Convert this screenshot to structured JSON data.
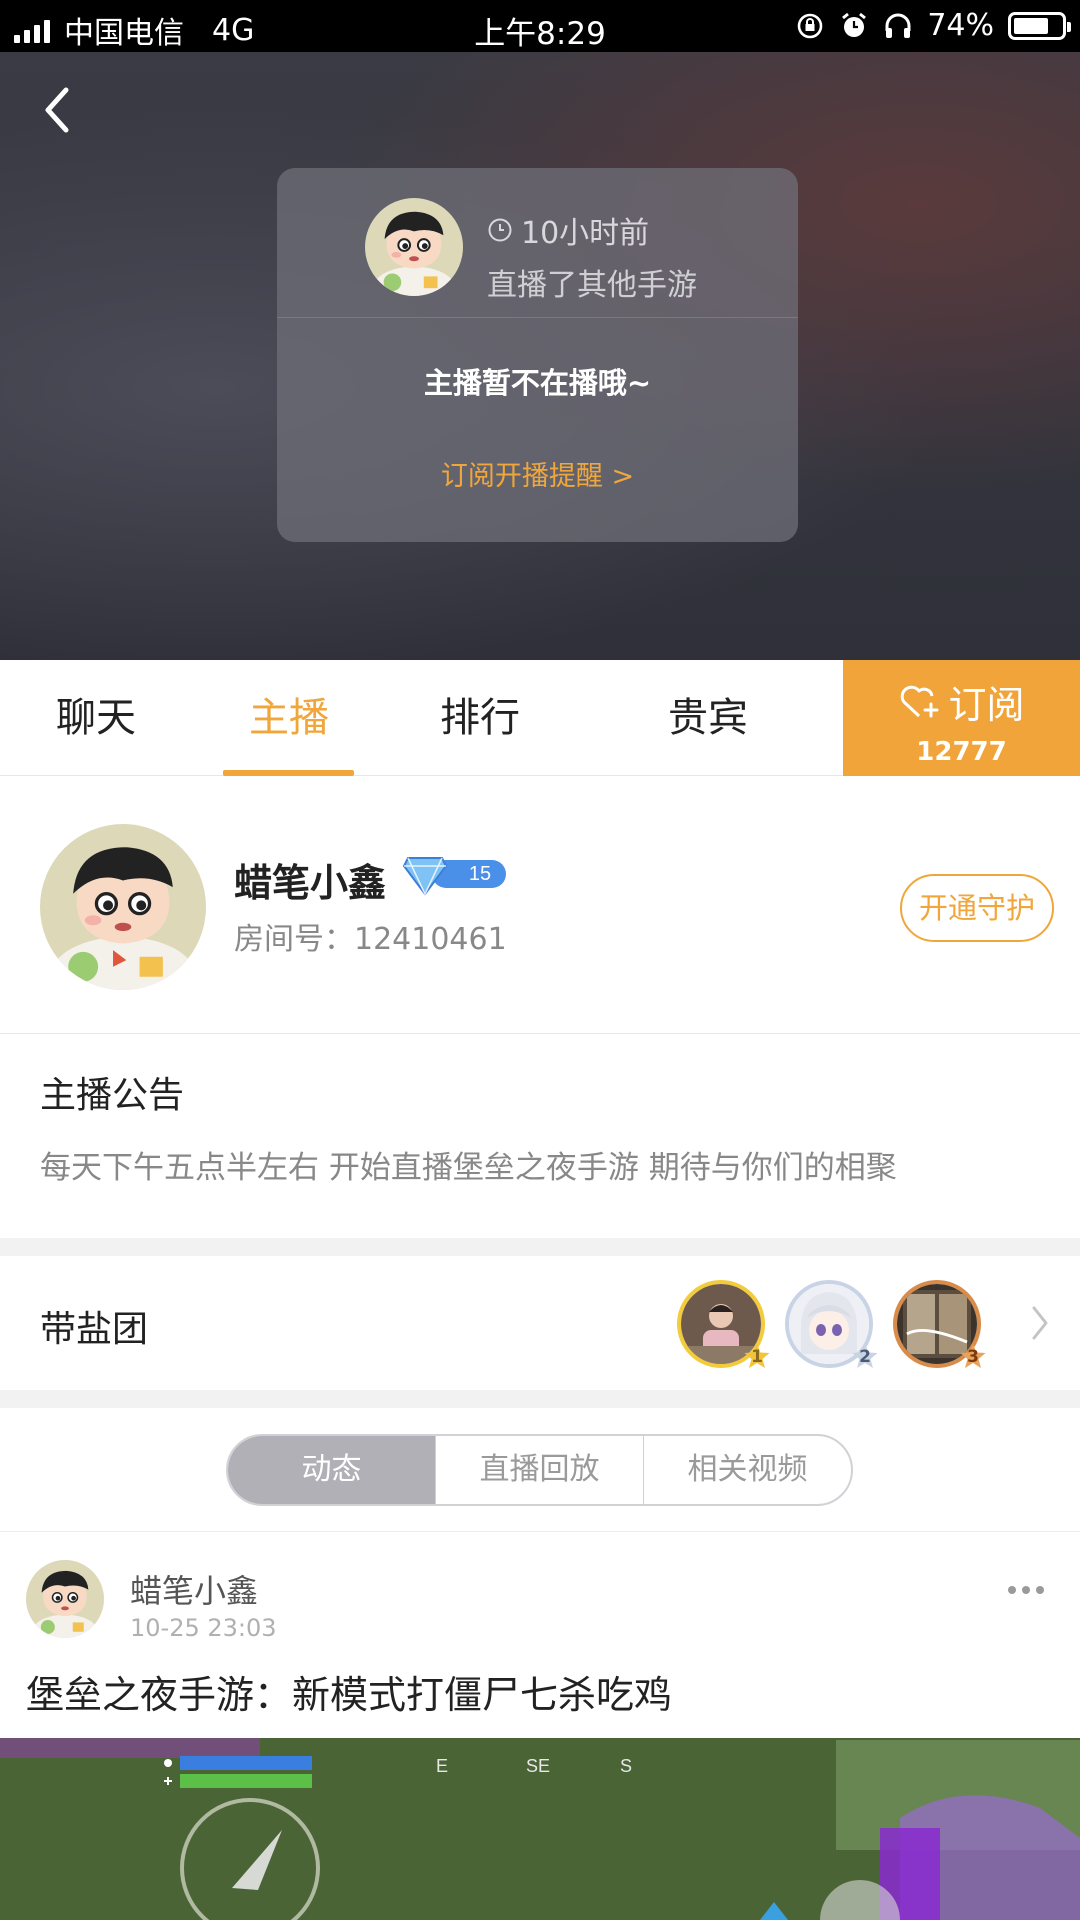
{
  "status_bar": {
    "carrier": "中国电信",
    "network": "4G",
    "time": "上午8:29",
    "battery": "74%"
  },
  "offline_card": {
    "time_ago": "10小时前",
    "description": "直播了其他手游",
    "message": "主播暂不在播哦~",
    "subscribe_reminder": "订阅开播提醒 >"
  },
  "tabs": [
    {
      "label": "聊天"
    },
    {
      "label": "主播"
    },
    {
      "label": "排行"
    },
    {
      "label": "贵宾"
    }
  ],
  "subscribe": {
    "label": "订阅",
    "count": "12777"
  },
  "streamer": {
    "name": "蜡笔小鑫",
    "level": "15",
    "room_id": "房间号：12410461",
    "guard_button": "开通守护"
  },
  "notice": {
    "title": "主播公告",
    "body": "每天下午五点半左右 开始直播堡垒之夜手游  期待与你们的相聚"
  },
  "fan_group": {
    "title": "带盐团",
    "ranks": [
      "1",
      "2",
      "3"
    ]
  },
  "segments": [
    {
      "label": "动态"
    },
    {
      "label": "直播回放"
    },
    {
      "label": "相关视频"
    }
  ],
  "post": {
    "author": "蜡笔小鑫",
    "time": "10-25 23:03",
    "title": "堡垒之夜手游：新模式打僵尸七杀吃鸡"
  },
  "colors": {
    "accent": "#f0a63a",
    "subscribe_bg": "#f0a43a"
  }
}
